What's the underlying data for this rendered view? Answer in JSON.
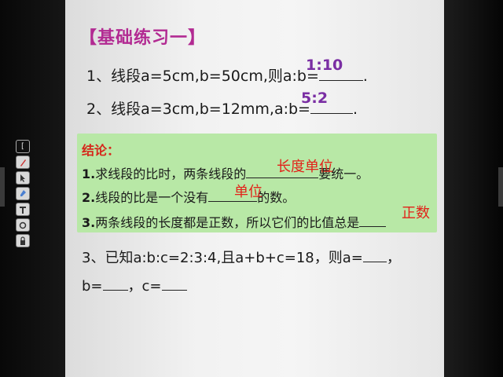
{
  "slide": {
    "title": "【基础练习一】",
    "q1": {
      "text": "1、线段a=5cm,b=50cm,则a:b=",
      "answer": "1:10",
      "end": "."
    },
    "q2": {
      "text": "2、线段a=3cm,b=12mm,a:b=",
      "answer": "5:2",
      "end": "."
    },
    "conclusion": {
      "title": "结论：",
      "line1_prefix": "1.",
      "line1_text": "求线段的比时，两条线段的",
      "line1_suffix": "要统一。",
      "line1_answer": "长度单位",
      "line2_prefix": "2.",
      "line2_text": "线段的比是一个没有",
      "line2_suffix": "的数。",
      "line2_answer": "单位",
      "line3_prefix": "3.",
      "line3_text": "两条线段的长度都是正数，所以它们的比值总是",
      "line3_answer": "正数"
    },
    "q3": {
      "line1_text": "3、已知a:b:c=2:3:4,且a+b+c=18，则a=",
      "line1_end": "，",
      "line2_b": "b=",
      "line2_c": "，c="
    }
  },
  "toolbar": {
    "items": [
      {
        "icon": "bracket-icon"
      },
      {
        "icon": "pen-icon"
      },
      {
        "icon": "arrow-icon"
      },
      {
        "icon": "brush-icon"
      },
      {
        "icon": "text-icon"
      },
      {
        "icon": "eraser-icon"
      },
      {
        "icon": "lock-icon"
      }
    ]
  },
  "colors": {
    "title": "#b22a92",
    "answer_purple": "#7a2ea3",
    "answer_red": "#e2231a",
    "conclusion_bg": "#b8e8a6"
  }
}
